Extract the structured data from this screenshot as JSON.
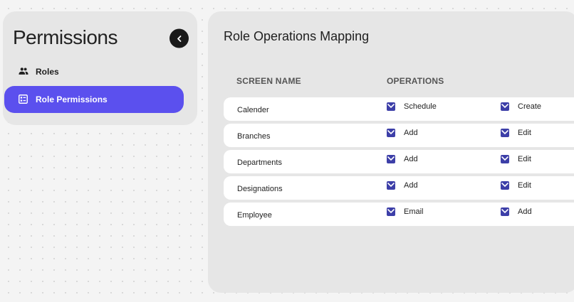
{
  "sidebar": {
    "title": "Permissions",
    "items": [
      {
        "label": "Roles",
        "icon": "group-icon",
        "active": false
      },
      {
        "label": "Role Permissions",
        "icon": "badge-list-icon",
        "active": true
      }
    ],
    "accent_color": "#5b50ee"
  },
  "main": {
    "title": "Role Operations Mapping",
    "columns": {
      "screen_name": "SCREEN NAME",
      "operations": "OPERATIONS"
    },
    "rows": [
      {
        "screen": "Calender",
        "ops": [
          {
            "label": "Schedule",
            "checked": true
          },
          {
            "label": "Create",
            "checked": true
          }
        ]
      },
      {
        "screen": "Branches",
        "ops": [
          {
            "label": "Add",
            "checked": true
          },
          {
            "label": "Edit",
            "checked": true
          }
        ]
      },
      {
        "screen": "Departments",
        "ops": [
          {
            "label": "Add",
            "checked": true
          },
          {
            "label": "Edit",
            "checked": true
          }
        ]
      },
      {
        "screen": "Designations",
        "ops": [
          {
            "label": "Add",
            "checked": true
          },
          {
            "label": "Edit",
            "checked": true
          }
        ]
      },
      {
        "screen": "Employee",
        "ops": [
          {
            "label": "Email",
            "checked": true
          },
          {
            "label": "Add",
            "checked": true
          }
        ]
      }
    ],
    "checkbox_color": "#3d3fa8"
  }
}
